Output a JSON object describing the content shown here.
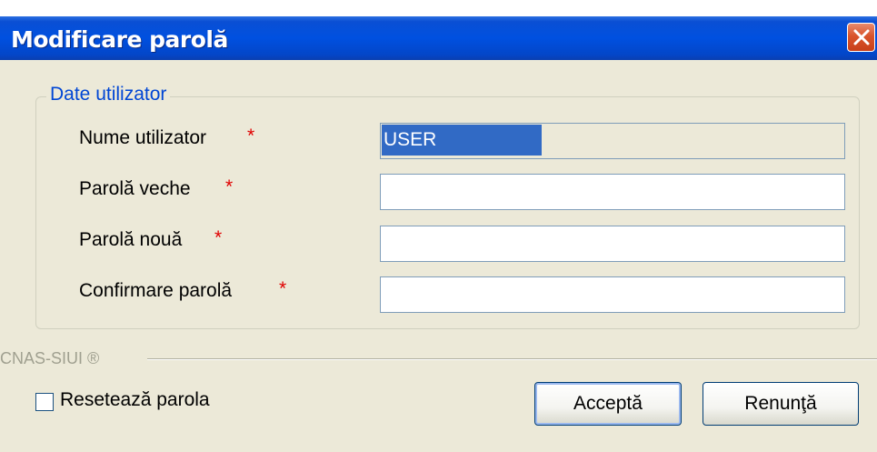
{
  "window": {
    "title": "Modificare parolă"
  },
  "group": {
    "legend": "Date utilizator",
    "fields": [
      {
        "label": "Nume utilizator",
        "required_mark": "*",
        "value": "USER",
        "readonly": true
      },
      {
        "label": "Parolă veche",
        "required_mark": "*",
        "value": ""
      },
      {
        "label": "Parolă nouă",
        "required_mark": "*",
        "value": ""
      },
      {
        "label": "Confirmare parolă",
        "required_mark": "*",
        "value": ""
      }
    ]
  },
  "brand": "CNAS-SIUI ®",
  "reset_checkbox": {
    "label": "Resetează parola",
    "checked": false
  },
  "buttons": {
    "accept": "Acceptă",
    "cancel": "Renunţă"
  },
  "colors": {
    "title_bar": "#0050e0",
    "legend": "#0046d5",
    "required": "#e00000",
    "selection": "#316ac5"
  },
  "icons": {
    "close": "close-icon"
  }
}
